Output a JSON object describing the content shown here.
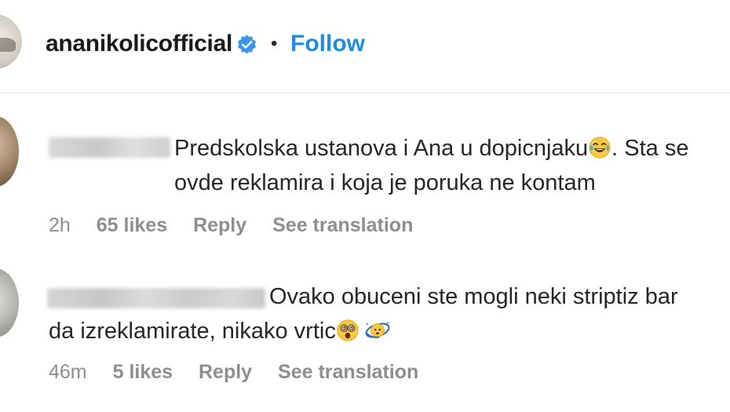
{
  "header": {
    "username": "ananikolicofficial",
    "separator": "•",
    "follow_label": "Follow"
  },
  "comments": [
    {
      "text_line1_prefix": "Predskolska ustanova i Ana u dopicnjaku",
      "text_line1_suffix": ". Sta se",
      "text_line2": "ovde reklamira i koja je poruka ne kontam",
      "emojis": [
        "face-with-tears-of-joy-icon"
      ],
      "time": "2h",
      "likes": "65 likes",
      "reply_label": "Reply",
      "translate_label": "See translation"
    },
    {
      "text_line1": "Ovako obuceni ste mogli neki striptiz bar",
      "text_line2_prefix": "da izreklamirate, nikako vrtic",
      "emojis": [
        "dizzy-face-icon",
        "face-with-spiral-eyes-icon"
      ],
      "time": "46m",
      "likes": "5 likes",
      "reply_label": "Reply",
      "translate_label": "See translation"
    }
  ],
  "colors": {
    "follow": "#1f8ce0",
    "verified": "#3897f0",
    "meta": "#8e8e8e",
    "text": "#262626",
    "divider": "#e6e6e6"
  }
}
